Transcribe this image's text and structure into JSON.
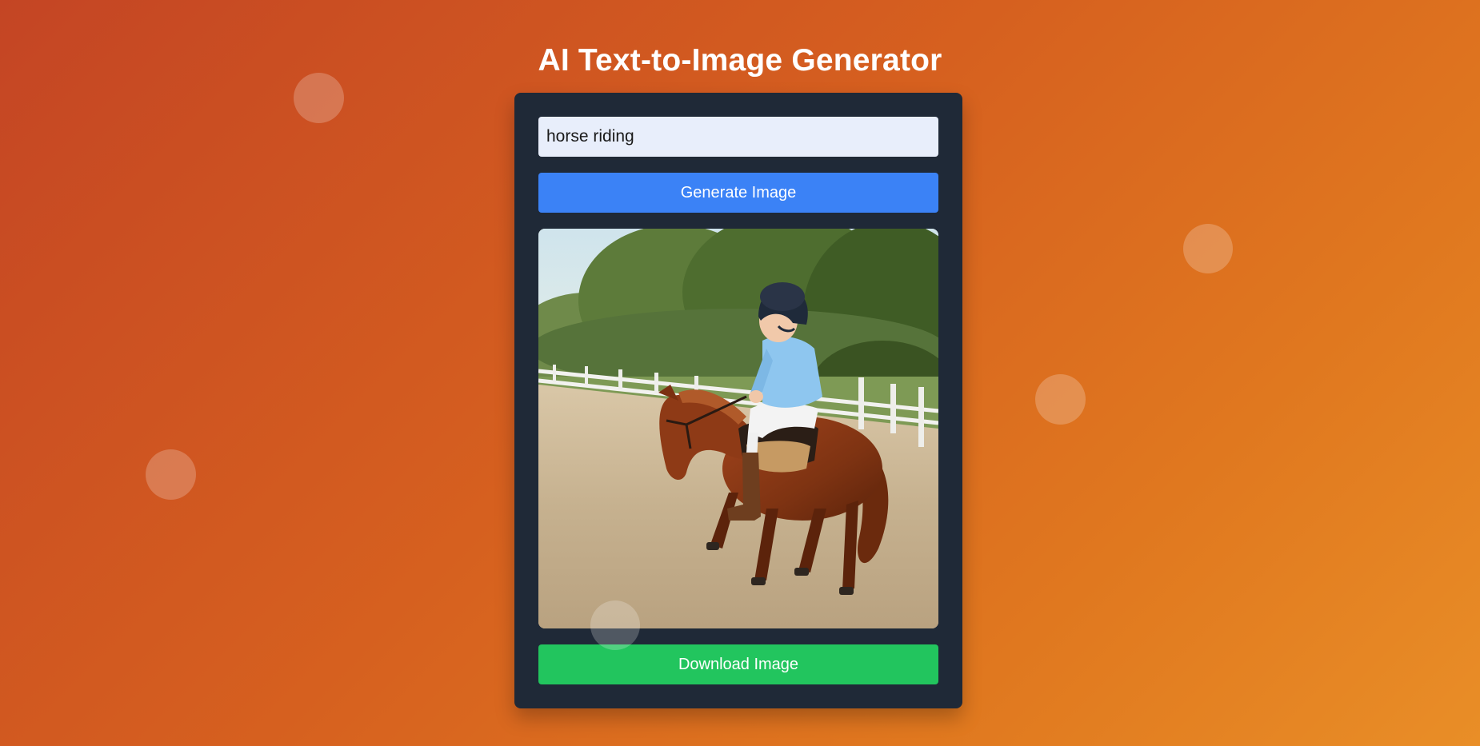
{
  "header": {
    "title": "AI Text-to-Image Generator"
  },
  "prompt": {
    "value": "horse riding",
    "placeholder": ""
  },
  "actions": {
    "generate_label": "Generate Image",
    "download_label": "Download Image"
  },
  "result_image": {
    "alt": "horse riding",
    "subject": "child in helmet and light blue shirt riding a chestnut pony in a sandy arena with a white fence and trees"
  },
  "colors": {
    "background_start": "#c44524",
    "background_end": "#e98e27",
    "card": "#1f2937",
    "input_bg": "#e8eefb",
    "generate_button": "#3b82f6",
    "download_button": "#22c55e"
  }
}
